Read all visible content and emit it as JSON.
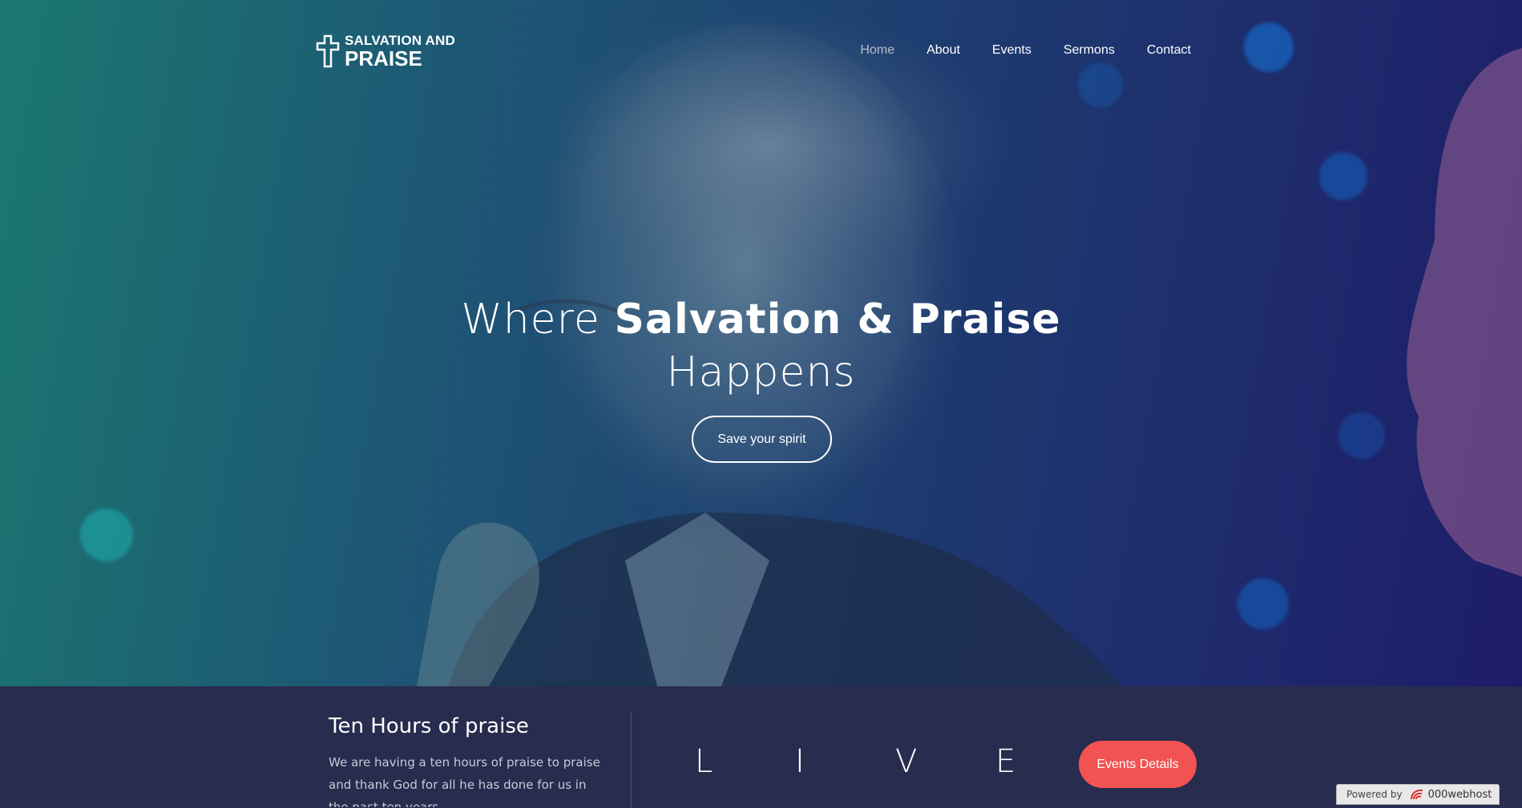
{
  "logo": {
    "line1": "SALVATION AND",
    "line2": "PRAISE"
  },
  "nav": {
    "items": [
      "Home",
      "About",
      "Events",
      "Sermons",
      "Contact"
    ]
  },
  "hero": {
    "headline_prefix": "Where ",
    "headline_bold": "Salvation & Praise",
    "headline_suffix": "Happens",
    "button_label": "Save your spirit"
  },
  "event": {
    "title": "Ten Hours of praise",
    "description": "We are having a ten hours of praise to praise and thank God for all he has done for us in the past ten years",
    "live_letters": [
      "L",
      "I",
      "V",
      "E"
    ],
    "button_label": "Events Details"
  },
  "footer_badge": {
    "prefix": "Powered by",
    "brand": "000webhost"
  },
  "colors": {
    "accent": "#f35252",
    "bottom_bar": "#282c4e"
  }
}
